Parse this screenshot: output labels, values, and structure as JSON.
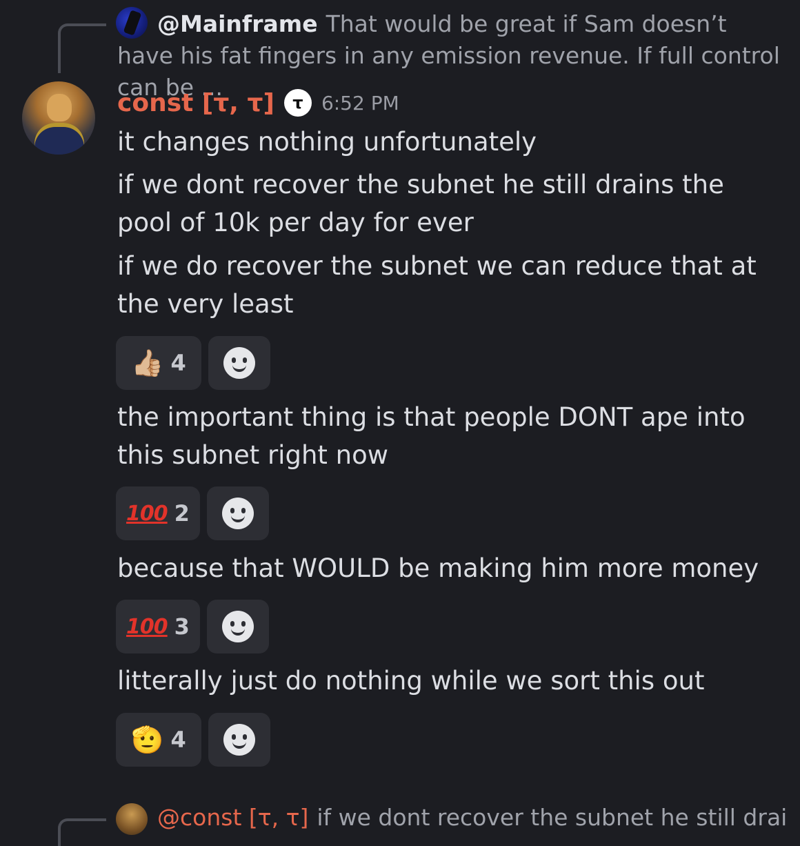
{
  "reply_top": {
    "mention": "@Mainframe",
    "text": "That would be great if Sam doesn’t have his fat fingers in any emission revenue. If full control can be ..."
  },
  "message": {
    "username": "const [τ, τ]",
    "badge_icon": "τ",
    "timestamp": "6:52 PM",
    "lines": [
      "it changes nothing unfortunately",
      "if we dont recover the subnet he still drains the pool of 10k per day for ever",
      "if we do recover the subnet we can reduce that at the very least",
      "the important thing is that people DONT ape into this subnet right now",
      "because that WOULD be making him more money",
      "litterally just do nothing while we sort this out"
    ]
  },
  "reactions": [
    {
      "emoji": "👍🏼",
      "icon": "thumbs-up-icon",
      "count": "4"
    },
    {
      "emoji": "💯",
      "icon": "hundred-points-icon",
      "count": "2"
    },
    {
      "emoji": "💯",
      "icon": "hundred-points-icon",
      "count": "3"
    },
    {
      "emoji": "🫡",
      "icon": "saluting-face-icon",
      "count": "4"
    }
  ],
  "reply_bottom": {
    "mention": "@const [τ, τ]",
    "text": "if we dont recover the subnet he still drains"
  },
  "colors": {
    "background": "#1c1d22",
    "username": "#e6674c",
    "reaction_bg": "#2d2e34"
  }
}
